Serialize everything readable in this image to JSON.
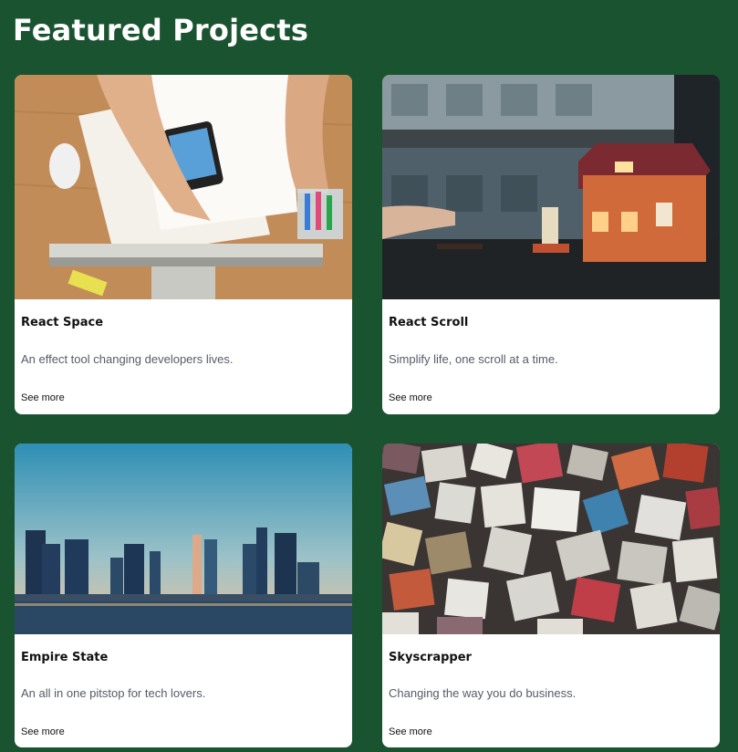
{
  "page": {
    "title": "Featured Projects"
  },
  "projects": [
    {
      "title": "React Space",
      "description": "An effect tool changing developers lives.",
      "link": "See more",
      "image": "desk-workspace-photo"
    },
    {
      "title": "React Scroll",
      "description": "Simplify life, one scroll at a time.",
      "link": "See more",
      "image": "toy-house-photo"
    },
    {
      "title": "Empire State",
      "description": "An all in one pitstop for tech lovers.",
      "link": "See more",
      "image": "city-skyline-photo"
    },
    {
      "title": "Skyscrapper",
      "description": "Changing the way you do business.",
      "link": "See more",
      "image": "colored-bricks-photo"
    }
  ],
  "colors": {
    "background": "#1a5330",
    "card": "#ffffff",
    "title_text": "#ffffff",
    "description_text": "#555b66"
  }
}
